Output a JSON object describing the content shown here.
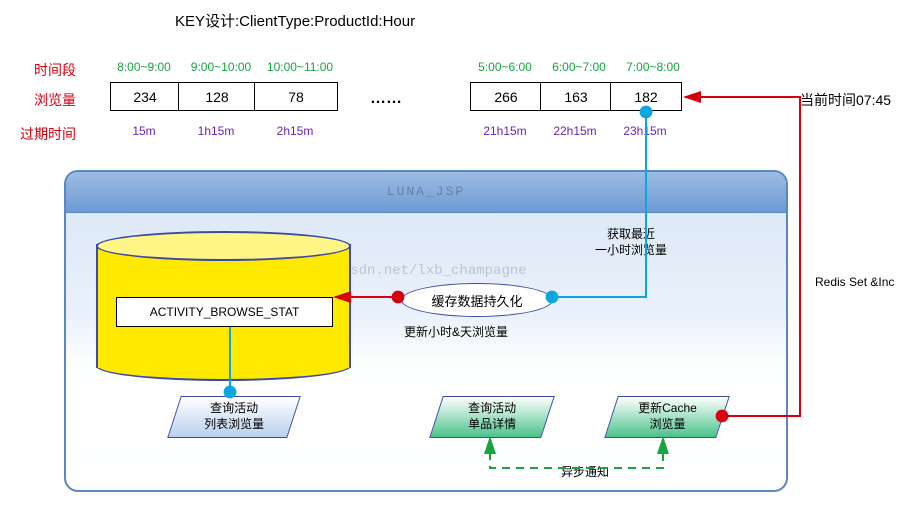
{
  "title": "KEY设计:ClientType:ProductId:Hour",
  "row_labels": {
    "time_range": "时间段",
    "views": "浏览量",
    "ttl": "过期时间"
  },
  "left_block": [
    {
      "range": "8:00~9:00",
      "views": "234",
      "ttl": "15m"
    },
    {
      "range": "9:00~10:00",
      "views": "128",
      "ttl": "1h15m"
    },
    {
      "range": "10:00~11:00",
      "views": "78",
      "ttl": "2h15m"
    }
  ],
  "right_block": [
    {
      "range": "5:00~6:00",
      "views": "266",
      "ttl": "21h15m"
    },
    {
      "range": "6:00~7:00",
      "views": "163",
      "ttl": "22h15m"
    },
    {
      "range": "7:00~8:00",
      "views": "182",
      "ttl": "23h15m"
    }
  ],
  "dots": "……",
  "current_time_label": "当前时间07:45",
  "redis_label": "Redis Set &Inc",
  "panel": {
    "header": "LUNA_JSP",
    "watermark": "http://blog.csdn.net/lxb_champagne",
    "table_name": "ACTIVITY_BROWSE_STAT",
    "cache_node": "缓存数据持久化",
    "cache_caption": "更新小时&天浏览量",
    "fetch_caption_l1": "获取最近",
    "fetch_caption_l2": "一小时浏览量",
    "par_list_l1": "查询活动",
    "par_list_l2": "列表浏览量",
    "par_detail_l1": "查询活动",
    "par_detail_l2": "单品详情",
    "par_update_l1": "更新Cache",
    "par_update_l2": "浏览量",
    "async_label": "异步通知"
  }
}
